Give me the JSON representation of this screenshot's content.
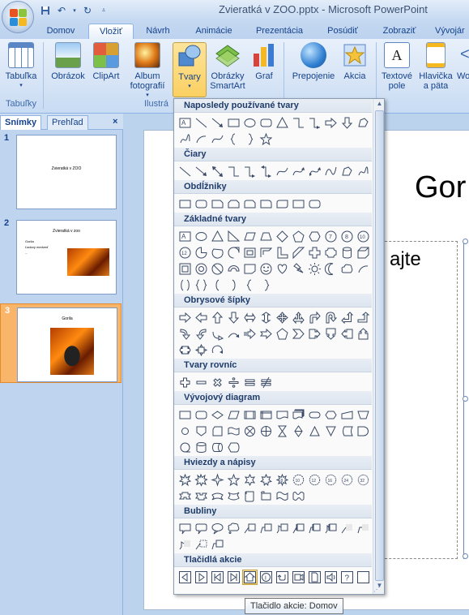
{
  "window": {
    "title": "Zvieratká v ZOO.pptx - Microsoft PowerPoint"
  },
  "quick_access": {
    "icons": [
      "save-icon",
      "undo-icon",
      "redo-icon",
      "customize-icon"
    ]
  },
  "ribbon": {
    "tabs": [
      {
        "label": "Domov"
      },
      {
        "label": "Vložiť",
        "active": true
      },
      {
        "label": "Návrh"
      },
      {
        "label": "Animácie"
      },
      {
        "label": "Prezentácia"
      },
      {
        "label": "Posúdiť"
      },
      {
        "label": "Zobraziť"
      },
      {
        "label": "Vývojár"
      }
    ],
    "groups": {
      "tabulky": {
        "label": "Tabuľky",
        "buttons": [
          {
            "label": "Tabuľka",
            "icon": "table-icon"
          }
        ]
      },
      "ilustracie": {
        "label": "Ilustrá",
        "buttons": [
          {
            "label": "Obrázok",
            "icon": "picture-icon"
          },
          {
            "label": "ClipArt",
            "icon": "clipart-icon"
          },
          {
            "label": "Album fotografií",
            "line1": "Album",
            "line2": "fotografií",
            "icon": "photo-album-icon"
          },
          {
            "label": "Tvary",
            "icon": "shapes-icon",
            "selected": true
          },
          {
            "label": "Obrázky SmartArt",
            "line1": "Obrázky",
            "line2": "SmartArt",
            "icon": "smartart-icon"
          },
          {
            "label": "Graf",
            "icon": "chart-icon"
          }
        ]
      },
      "prepojenia": {
        "buttons": [
          {
            "label": "Prepojenie",
            "icon": "hyperlink-icon"
          },
          {
            "label": "Akcia",
            "icon": "action-icon"
          }
        ]
      },
      "text": {
        "buttons": [
          {
            "label": "Textové pole",
            "line1": "Textové",
            "line2": "pole",
            "icon": "textbox-icon"
          },
          {
            "label": "Hlavička a päta",
            "line1": "Hlavička",
            "line2": "a päta",
            "icon": "header-footer-icon"
          },
          {
            "label": "Wo",
            "icon": "wordart-icon"
          }
        ]
      }
    }
  },
  "left_panel": {
    "tabs": [
      {
        "label": "Snímky",
        "active": true
      },
      {
        "label": "Prehľad"
      }
    ],
    "close": "×",
    "slides": [
      {
        "number": "1",
        "title": "Zvieratká v ZOO"
      },
      {
        "number": "2",
        "title": "Zvieratká v zoo",
        "bullets": [
          "Gorila",
          "Ľadový medveď",
          "..."
        ]
      },
      {
        "number": "3",
        "title": "Gorila",
        "active": true
      }
    ]
  },
  "slide": {
    "title_partial": "Gor",
    "body_partial": "ajte"
  },
  "gallery": {
    "sections": [
      {
        "title": "Naposledy používané tvary",
        "rows": [
          [
            "textbox",
            "line",
            "arrow",
            "rect",
            "oval",
            "rounded",
            "triangle",
            "elbow",
            "elbow2",
            "rightarrow",
            "downarrow",
            "freeform"
          ],
          [
            "scribble",
            "arc",
            "curve",
            "lbrace",
            "rbrace",
            "star"
          ]
        ]
      },
      {
        "title": "Čiary",
        "rows": [
          [
            "line",
            "arrow",
            "doublearrow",
            "elbow",
            "elbowarrow",
            "elbowdouble",
            "curve",
            "curvearrow",
            "curvedouble",
            "curve2",
            "freeform",
            "scribble"
          ]
        ]
      },
      {
        "title": "Obdĺžniky",
        "rows": [
          [
            "rect",
            "rounded",
            "snip1",
            "snip2",
            "snipround",
            "round1",
            "round2",
            "rect",
            "rounded"
          ]
        ]
      },
      {
        "title": "Základné tvary",
        "rows": [
          [
            "textbox",
            "oval",
            "triangle",
            "rtriangle",
            "parallelogram",
            "trapezoid",
            "diamond",
            "pentagon",
            "hexagon",
            "n7",
            "n8",
            "n10"
          ],
          [
            "n12",
            "pie",
            "chord",
            "teardrop",
            "frame",
            "halfframe",
            "lshape",
            "diagstripe",
            "cross",
            "plaque",
            "can",
            "cube"
          ],
          [
            "bevel",
            "donut",
            "nosymbol",
            "blockarc",
            "foldedcorner",
            "smiley",
            "heart",
            "lightning",
            "sun",
            "moon",
            "cloud",
            "arc"
          ],
          [
            "dbracket",
            "dbrace",
            "lbracket",
            "rbracket",
            "lbrace",
            "rbrace"
          ]
        ]
      },
      {
        "title": "Obrysové šípky",
        "rows": [
          [
            "rightarrow",
            "leftarrow",
            "uparrow",
            "downarrow",
            "lrarrow",
            "udarrow",
            "quadarrow",
            "lrup",
            "bent",
            "uturn",
            "leftup",
            "bentup"
          ]
        ],
        "rows2": [
          [
            "curvedr",
            "curvedl",
            "curvedu",
            "curvedd",
            "striped",
            "notched",
            "pentagon",
            "chevron",
            "rightcallout",
            "downcallout",
            "leftcallout",
            "upcallout"
          ],
          [
            "lrcallout",
            "quadcallout",
            "circular"
          ]
        ]
      },
      {
        "title": "Tvary rovníc",
        "rows": [
          [
            "plus",
            "minus",
            "multiply",
            "divide",
            "equal",
            "notequal"
          ]
        ]
      },
      {
        "title": "Vývojový diagram",
        "rows": [
          [
            "process",
            "altprocess",
            "decision",
            "data",
            "predefined",
            "internal",
            "document",
            "multidoc",
            "terminator",
            "prep",
            "manualinput",
            "manualop"
          ],
          [
            "connector",
            "offpage",
            "card",
            "punched",
            "summing",
            "or",
            "collate",
            "sort",
            "extract",
            "merge",
            "stored",
            "delay"
          ],
          [
            "seqaccess",
            "magdisk",
            "directaccess",
            "display"
          ]
        ]
      },
      {
        "title": "Hviezdy a nápisy",
        "rows": [
          [
            "burst1",
            "burst2",
            "star4",
            "star5",
            "star6",
            "star7",
            "star8",
            "star10",
            "star12",
            "star16",
            "star24",
            "star32"
          ],
          [
            "ribbonup",
            "ribbondown",
            "curvedup",
            "curveddown",
            "vscroll",
            "hscroll",
            "wave",
            "dwave"
          ]
        ]
      },
      {
        "title": "Bubliny",
        "rows": [
          [
            "rectcallout",
            "roundcallout",
            "ovalcallout",
            "cloudcallout",
            "line1",
            "line2",
            "line3",
            "line1b",
            "line2b",
            "line3b",
            "line1c",
            "line2c"
          ],
          [
            "line3c",
            "line1d",
            "line2d"
          ]
        ]
      },
      {
        "title": "Tlačidlá akcie",
        "rows": [
          [
            "back",
            "forward",
            "begin",
            "end",
            "home",
            "info",
            "return",
            "movie",
            "doc",
            "sound",
            "help",
            "blank"
          ]
        ]
      }
    ]
  },
  "tooltip": "Tlačidlo akcie: Domov",
  "colors": {
    "ribbon_bg": "#d3e2f5",
    "selected": "#fbd062",
    "text": "#15428b"
  }
}
